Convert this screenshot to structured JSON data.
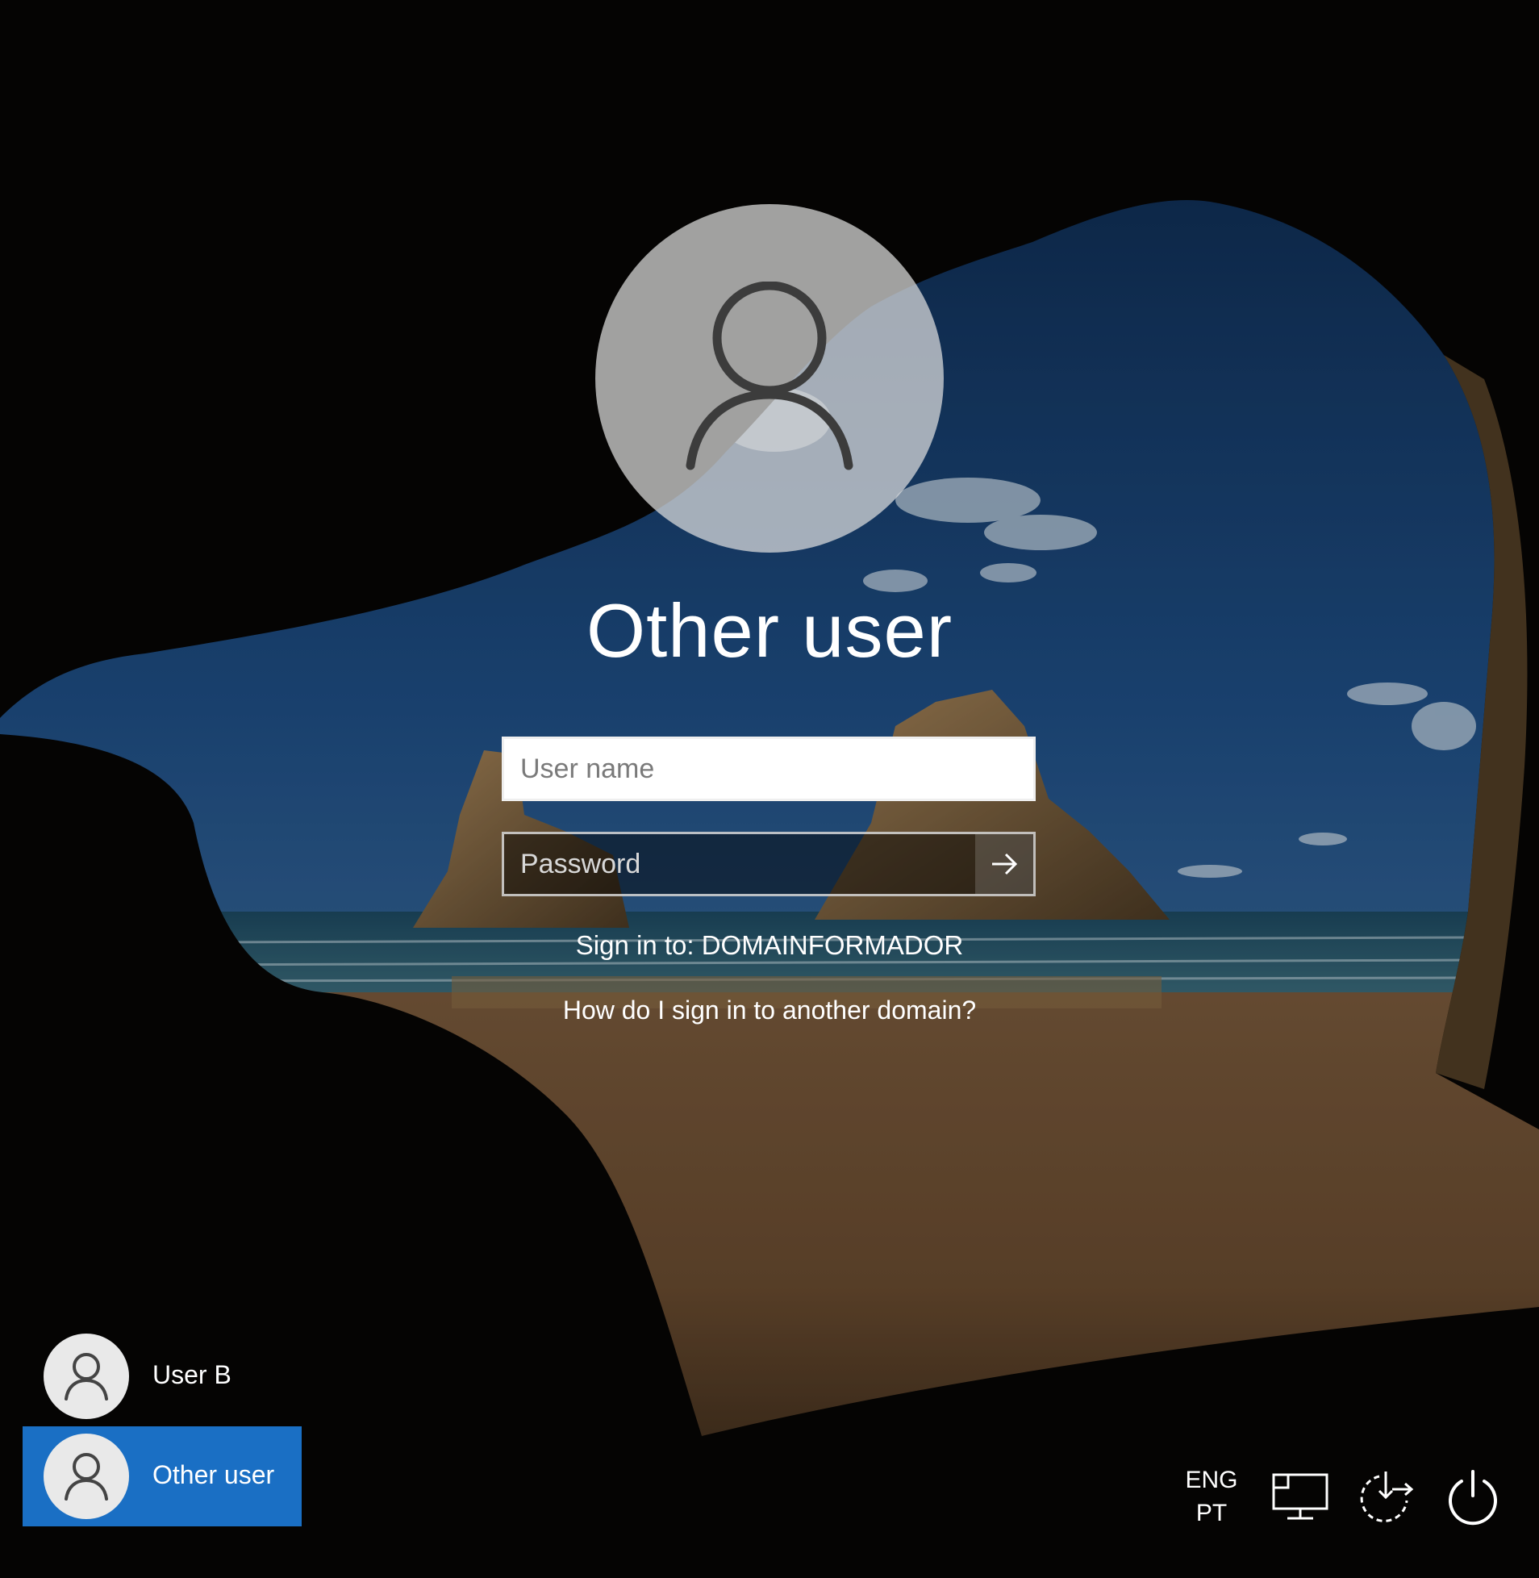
{
  "login": {
    "title": "Other user",
    "username_placeholder": "User name",
    "password_placeholder": "Password",
    "submit_label": "Submit",
    "sign_in_to": "Sign in to: DOMAINFORMADOR",
    "other_domain_link": "How do I sign in to another domain?"
  },
  "users": [
    {
      "name": "User B",
      "selected": false,
      "icon": "person-icon"
    },
    {
      "name": "Other user",
      "selected": true,
      "icon": "person-icon"
    }
  ],
  "system_tray": {
    "language_top": "ENG",
    "language_bottom": "PT",
    "network_icon": "network-icon",
    "accessibility_icon": "ease-of-access-icon",
    "power_icon": "power-icon"
  },
  "colors": {
    "selected_user_tile": "#1a6fc4",
    "avatar_circle": "#dedede"
  }
}
